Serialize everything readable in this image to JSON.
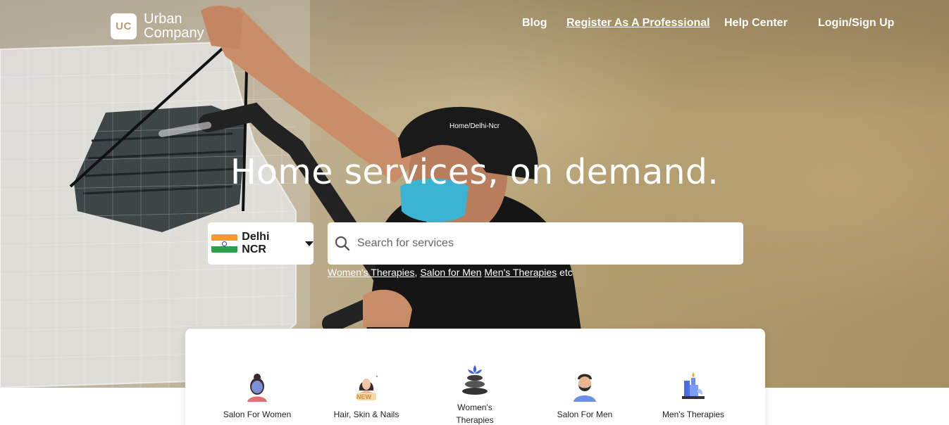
{
  "brand": {
    "mark": "UC",
    "name": "Urban Company"
  },
  "nav": {
    "blog": "Blog",
    "register": "Register As A Professional",
    "help": "Help Center",
    "login": "Login/Sign Up"
  },
  "breadcrumb": "Home/Delhi-Ncr",
  "headline": "Home services, on demand.",
  "city": {
    "selected": "Delhi NCR"
  },
  "search": {
    "placeholder": "Search for services"
  },
  "suggestions": {
    "items": [
      "Women's Therapies",
      "Salon for Men",
      "Men's Therapies"
    ],
    "separator": ",",
    "suffix": " etc"
  },
  "categories": [
    {
      "label": "Salon For Women",
      "icon": "woman-face-mask-icon"
    },
    {
      "label": "Hair, Skin & Nails",
      "icon": "woman-new-badge-icon",
      "badge": "NEW"
    },
    {
      "label": "Women's Therapies",
      "icon": "lotus-stones-icon"
    },
    {
      "label": "Salon For Men",
      "icon": "bearded-man-icon"
    },
    {
      "label": "Men's Therapies",
      "icon": "candle-spa-icon"
    }
  ]
}
